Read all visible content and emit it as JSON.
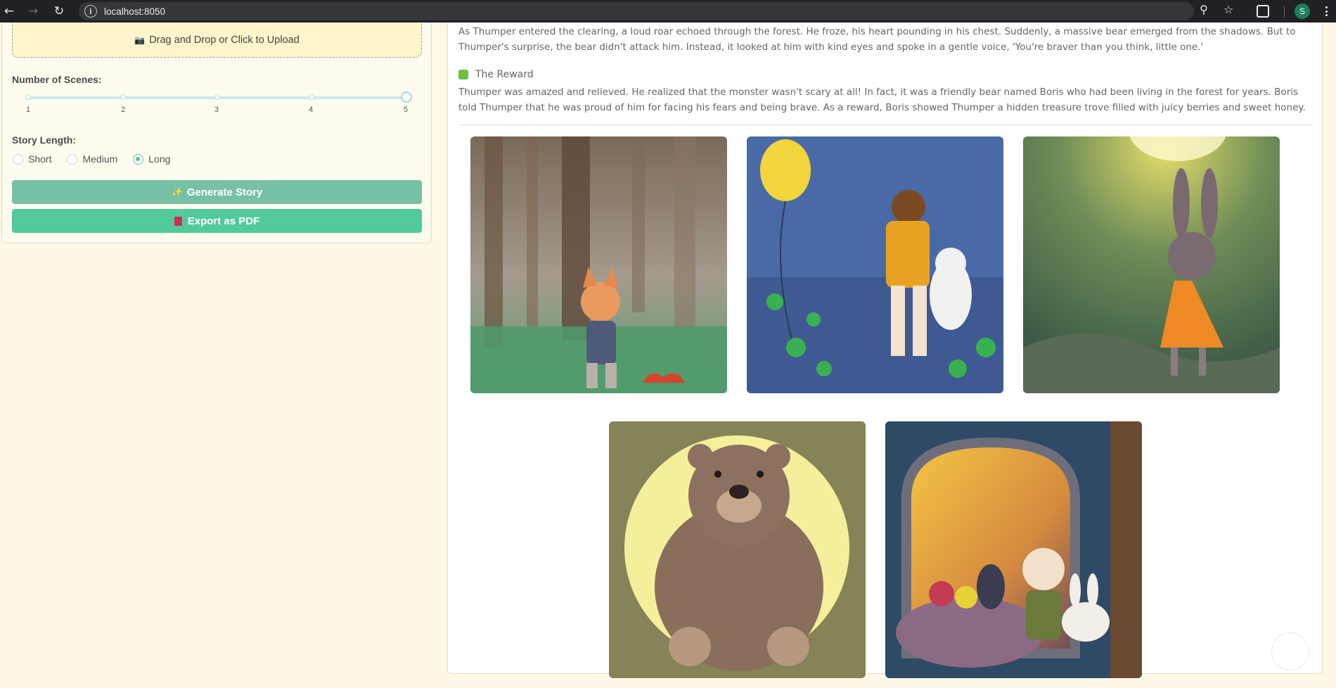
{
  "browser": {
    "url": "localhost:8050",
    "profile_initial": "S"
  },
  "sidebar": {
    "upload_label": "Drag and Drop or Click to Upload",
    "scenes_label": "Number of Scenes:",
    "scene_marks": [
      "1",
      "2",
      "3",
      "4",
      "5"
    ],
    "scenes_value": 5,
    "length_label": "Story Length:",
    "length_options": [
      "Short",
      "Medium",
      "Long"
    ],
    "length_selected": "Long",
    "generate_label": "Generate Story",
    "export_label": "Export as PDF"
  },
  "story": {
    "paragraph_1_line_1": "As Thumper entered the clearing, a loud roar echoed through the forest. He froze, his heart pounding in his chest. Suddenly, a massive bear emerged from the shadows. But to",
    "paragraph_1_line_2": "Thumper's surprise, the bear didn't attack him. Instead, it looked at him with kind eyes and spoke in a gentle voice, 'You're braver than you think, little one.'",
    "section_title": "The Reward",
    "paragraph_2_line_1": "Thumper was amazed and relieved. He realized that the monster wasn't scary at all! In fact, it was a friendly bear named Boris who had been living in the forest for years. Boris",
    "paragraph_2_line_2": "told Thumper that he was proud of him for facing his fears and being brave. As a reward, Boris showed Thumper a hidden treasure trove filled with juicy berries and sweet honey."
  },
  "colors": {
    "page_bg": "#fef9e6",
    "generate_btn": "#76c0a7",
    "export_btn": "#52ca9c",
    "slider_track": "#c7ecf2",
    "radio_accent": "#5fc39c"
  }
}
